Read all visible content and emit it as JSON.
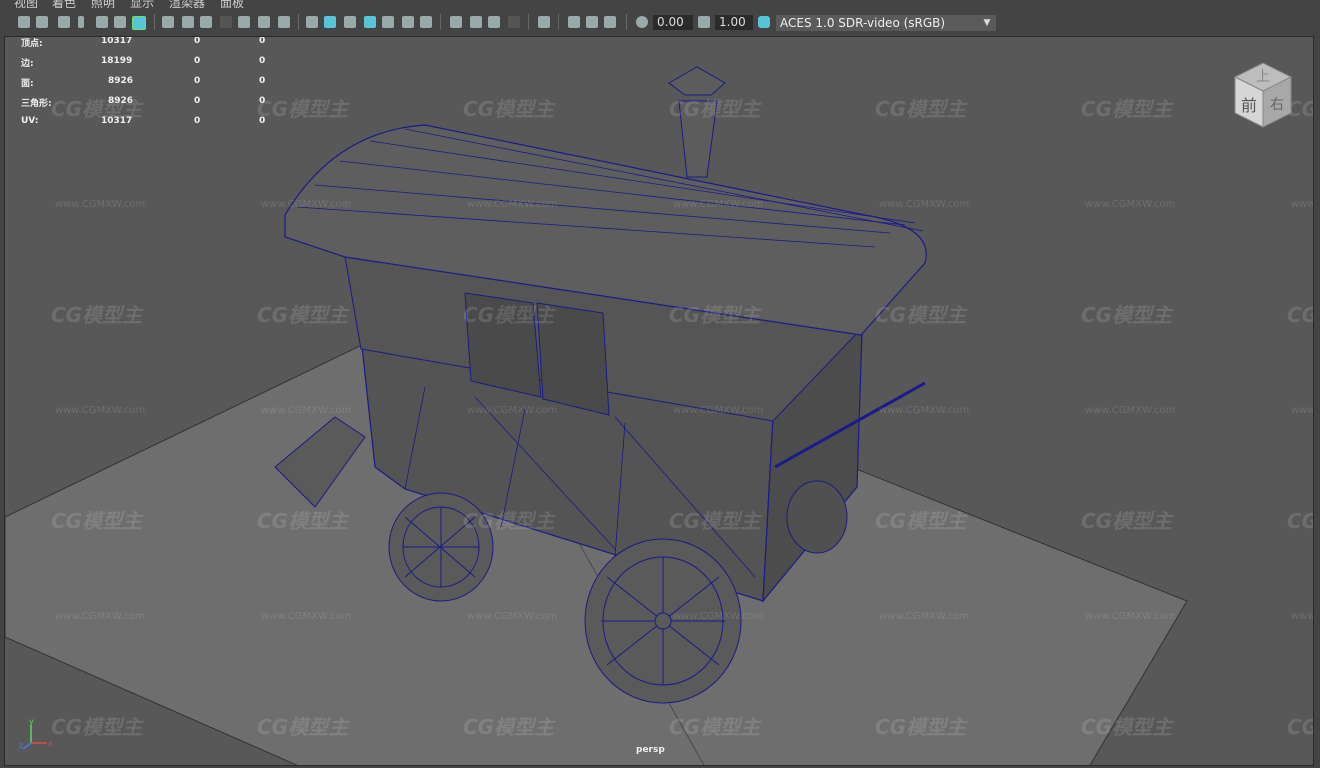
{
  "menu": [
    "视图",
    "着色",
    "照明",
    "显示",
    "渲染器",
    "面板"
  ],
  "toolbar": {
    "exposure_value": "0.00",
    "gamma_value": "1.00",
    "color_space": "ACES 1.0 SDR-video (sRGB)"
  },
  "hud": {
    "rows": [
      {
        "label": "顶点:",
        "value": "10317",
        "a": "0",
        "b": "0"
      },
      {
        "label": "边:",
        "value": "18199",
        "a": "0",
        "b": "0"
      },
      {
        "label": "面:",
        "value": "8926",
        "a": "0",
        "b": "0"
      },
      {
        "label": "三角形:",
        "value": "8926",
        "a": "0",
        "b": "0"
      },
      {
        "label": "UV:",
        "value": "10317",
        "a": "0",
        "b": "0"
      }
    ]
  },
  "viewcube": {
    "top": "上",
    "front": "前",
    "right": "右"
  },
  "camera_label": "persp",
  "watermark": {
    "logo": "CG模型主",
    "url": "www.CGMXW.com"
  },
  "axis": {
    "y": "y",
    "z": "z",
    "x": "x"
  },
  "colors": {
    "wire": "#1a1a8c",
    "accent": "#58c4d8"
  }
}
